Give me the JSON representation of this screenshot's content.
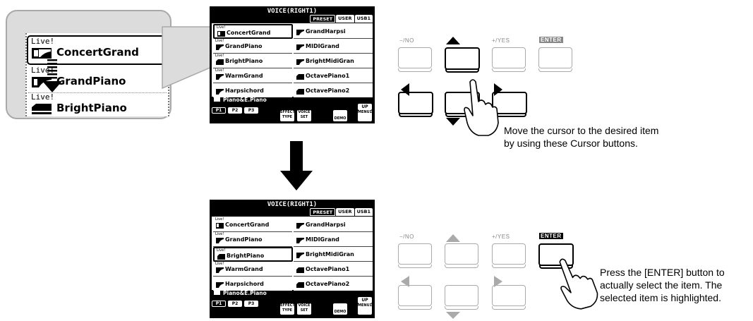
{
  "zoom": {
    "items": [
      {
        "live": "Live!",
        "name": "ConcertGrand"
      },
      {
        "live": "Live!",
        "name": "GrandPiano"
      },
      {
        "live": "Live!",
        "name": "BrightPiano"
      }
    ]
  },
  "screen": {
    "title": "VOICE(RIGHT1)",
    "tabs": [
      "PRESET",
      "USER",
      "USB1"
    ],
    "left_voices": [
      {
        "live": "Live!",
        "name": "ConcertGrand"
      },
      {
        "live": "Live!",
        "name": "GrandPiano"
      },
      {
        "live": "Live!",
        "name": "BrightPiano"
      },
      {
        "live": "Live!",
        "name": "WarmGrand"
      },
      {
        "live": "",
        "name": "Harpsichord"
      }
    ],
    "right_voices": [
      {
        "name": "GrandHarpsi"
      },
      {
        "name": "MIDIGrand"
      },
      {
        "name": "BrightMidiGran"
      },
      {
        "name": "OctavePiano1"
      },
      {
        "name": "OctavePiano2"
      }
    ],
    "category": "Piano&E.Piano",
    "pages": [
      "P1",
      "P2",
      "P3"
    ],
    "effect_type": "EFFECT TYPE",
    "voice_set": "VOICE SET",
    "demo": "DEMO",
    "up": "UP",
    "menu": "MENU1"
  },
  "buttons": {
    "no": "−/NO",
    "yes": "+/YES",
    "enter": "ENTER"
  },
  "captions": {
    "cursor": [
      "Move the cursor to the desired item",
      "by using these Cursor buttons."
    ],
    "enter": [
      "Press the [ENTER] button to",
      "actually select the item. The",
      "selected item is highlighted."
    ]
  }
}
